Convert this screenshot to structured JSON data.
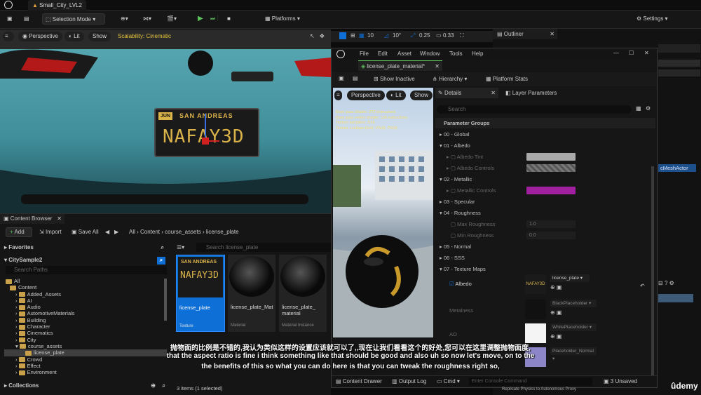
{
  "app": {
    "project_title": "Small_City_LVL2"
  },
  "toolbar": {
    "mode_label": "Selection Mode",
    "platforms_label": "Platforms",
    "settings_label": "Settings"
  },
  "viewport": {
    "perspective_label": "Perspective",
    "lit_label": "Lit",
    "show_label": "Show",
    "scalability_label": "Scalability: Cinematic",
    "grid_value": "10",
    "angle_value": "10°",
    "scale_value": "0.25",
    "speed_value": "0.33",
    "plate_top": "SAN ANDREAS",
    "plate_main": "NAFAY3D",
    "plate_badge": "JUN"
  },
  "outliner": {
    "title": "Outliner",
    "actor_text": "cMeshActor"
  },
  "content_browser": {
    "title": "Content Browser",
    "add_label": "Add",
    "import_label": "Import",
    "save_all_label": "Save All",
    "path": [
      "All",
      "Content",
      "course_assets",
      "license_plate"
    ],
    "favorites_label": "Favorites",
    "project_label": "CitySample2",
    "search_paths_placeholder": "Search Paths",
    "search_placeholder": "Search license_plate",
    "tree": [
      "All",
      "Content",
      "Added_Assets",
      "AI",
      "Audio",
      "AutomotiveMaterials",
      "Building",
      "Character",
      "Cinematics",
      "City",
      "course_assets",
      "license_plate",
      "Crowd",
      "Effect",
      "Environment"
    ],
    "collections_label": "Collections",
    "assets": [
      {
        "name": "license_plate",
        "type": "Texture"
      },
      {
        "name": "license_plate_Mat",
        "type": "Material"
      },
      {
        "name": "license_plate_ material",
        "type": "Material Instance"
      }
    ],
    "status": "3 items (1 selected)"
  },
  "material_editor": {
    "menu": [
      "File",
      "Edit",
      "Asset",
      "Window",
      "Tools",
      "Help"
    ],
    "tab_title": "license_plate_material",
    "show_inactive_label": "Show Inactive",
    "hierarchy_label": "Hierarchy",
    "platform_stats_label": "Platform Stats",
    "perspective_label": "Perspective",
    "lit_label": "Lit",
    "show_label": "Show",
    "stats_lines": [
      "Base pass shader: 272 instructions",
      "Base pass vertex shader: 136 instructions",
      "Texture samplers: 3/16",
      "Texture Lookups (Est): VS(0), PS(4)"
    ],
    "details_tab": "Details",
    "layer_tab": "Layer Parameters",
    "search_placeholder": "Search",
    "param_groups_header": "Parameter Groups",
    "groups": [
      {
        "label": "00 - Global"
      },
      {
        "label": "01 - Albedo"
      },
      {
        "label": "02 - Metallic"
      },
      {
        "label": "03 - Specular"
      },
      {
        "label": "04 - Roughness"
      },
      {
        "label": "05 - Normal"
      },
      {
        "label": "06 - SSS"
      },
      {
        "label": "07 - Texture Maps"
      }
    ],
    "params": {
      "albedo_tint": "Albedo Tint",
      "albedo_controls": "Albedo Controls",
      "metallic_controls": "Metallic Controls",
      "max_roughness": "Max Roughness",
      "max_roughness_value": "1.0",
      "min_roughness": "Min Roughness",
      "min_roughness_value": "0.0",
      "albedo_map": "Albedo",
      "albedo_map_value": "license_plate",
      "metalness_map": "Metalness",
      "metalness_value": "BlackPlaceholder",
      "ao_map": "AO",
      "ao_value": "WhitePlaceholder",
      "normal_value": "Placeholder_Normal"
    },
    "content_drawer_label": "Content Drawer",
    "output_log_label": "Output Log",
    "cmd_label": "Cmd",
    "console_placeholder": "Enter Console Command",
    "unsaved_label": "3 Unsaved",
    "replicate_text": "Replicate Physics to Autonomous Proxy"
  },
  "colors": {
    "accent": "#0e6fd6",
    "metallic_swatch": "#a020a0",
    "albedo_tint": "#a9a9a9",
    "plate_yellow": "#d9b24a"
  },
  "subtitles": {
    "chinese": "抛物面的比例是不错的,我认为类似这样的设置应该就可以了,,现在让我们看看这个的好处,您可以在这里调整抛物面度,",
    "line1": "that the aspect ratio is fine i think something like that should be good and also uh so now let's move, on to the",
    "line2": "the benefits of this so what you can do here is that you can tweak the roughness right so,"
  },
  "watermark": "ûdemy"
}
